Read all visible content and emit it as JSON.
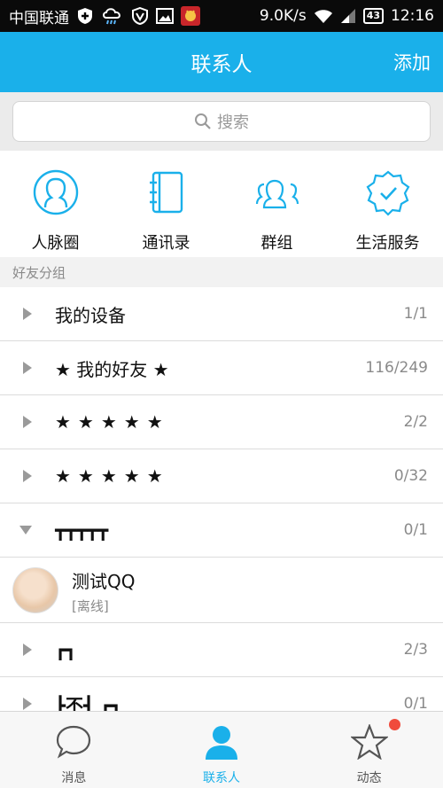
{
  "status_bar": {
    "carrier": "中国联通",
    "speed": "9.0K/s",
    "battery": "43",
    "time": "12:16",
    "icons": [
      "shield-plus-icon",
      "weather-cloud-icon",
      "vpn-icon",
      "image-icon",
      "app-icon",
      "wifi-icon",
      "signal-icon",
      "battery-icon"
    ]
  },
  "header": {
    "title": "联系人",
    "action": "添加"
  },
  "search": {
    "placeholder": "搜索"
  },
  "quick_entries": [
    {
      "label": "人脉圈",
      "icon": "person-circle-icon"
    },
    {
      "label": "通讯录",
      "icon": "address-book-icon"
    },
    {
      "label": "群组",
      "icon": "group-icon"
    },
    {
      "label": "生活服务",
      "icon": "verified-badge-icon"
    }
  ],
  "section": {
    "title": "好友分组"
  },
  "groups": [
    {
      "name": "我的设备",
      "count": "1/1",
      "expanded": false
    },
    {
      "name": "★ 我的好友 ★",
      "count": "116/249",
      "expanded": false
    },
    {
      "name": "★★★★★",
      "count": "2/2",
      "expanded": false
    },
    {
      "name": "★★★★★",
      "count": "0/32",
      "expanded": false
    },
    {
      "name": "┳┳┳┳┳",
      "count": "0/1",
      "expanded": true
    },
    {
      "name": "┏┓",
      "count": "2/3",
      "expanded": false
    },
    {
      "name": "┣不┫ ┏┓",
      "count": "0/1",
      "expanded": false
    }
  ],
  "contact": {
    "name": "测试QQ",
    "status": "[离线]"
  },
  "tabs": [
    {
      "label": "消息",
      "icon": "chat-bubble-icon",
      "active": false
    },
    {
      "label": "联系人",
      "icon": "person-icon",
      "active": true
    },
    {
      "label": "动态",
      "icon": "star-icon",
      "active": false,
      "has_badge": true
    }
  ],
  "colors": {
    "accent": "#1ab0ea",
    "badge": "#f04b3c"
  }
}
